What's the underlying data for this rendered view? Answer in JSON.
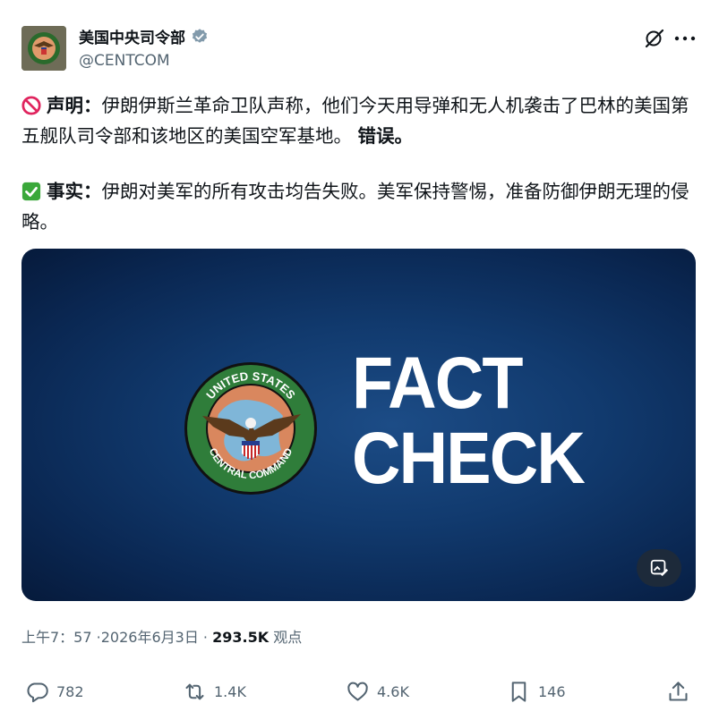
{
  "author": {
    "name": "美国中央司令部",
    "handle": "@CENTCOM",
    "verified_icon": "verified-badge-icon"
  },
  "tweet": {
    "claim_label": "声明：",
    "claim_text": "伊朗伊斯兰革命卫队声称，他们今天用导弹和无人机袭击了巴林的美国第五舰队司令部和该地区的美国空军基地。",
    "claim_verdict": "错误。",
    "fact_label": "事实：",
    "fact_text": "伊朗对美军的所有攻击均告失败。美军保持警惕，准备防御伊朗无理的侵略。"
  },
  "media": {
    "headline_line1": "FACT",
    "headline_line2": "CHECK",
    "seal_top": "UNITED STATES",
    "seal_bottom": "CENTRAL COMMAND"
  },
  "meta": {
    "time": "上午7：57",
    "date": "2026年6月3日",
    "views_count": "293.5K",
    "views_label": "观点"
  },
  "actions": {
    "replies": "782",
    "reposts": "1.4K",
    "likes": "4.6K",
    "bookmarks": "146"
  },
  "colors": {
    "text": "#0f1419",
    "secondary": "#536471",
    "media_bg": "#0d2e5e",
    "verified": "#829aab"
  }
}
